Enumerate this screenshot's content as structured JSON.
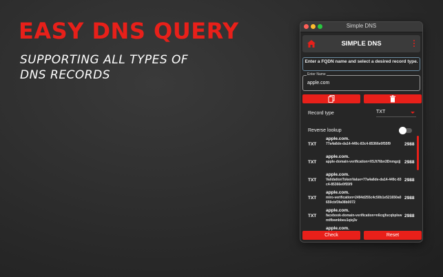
{
  "promo": {
    "title": "EASY DNS QUERY",
    "subtitle": "SUPPORTING ALL TYPES OF DNS RECORDS"
  },
  "window": {
    "title": "Simple DNS"
  },
  "app": {
    "title": "SIMPLE DNS",
    "home_icon": "home-icon",
    "menu_icon": "kebab-menu-icon"
  },
  "info_text": "Enter a FQDN name and select a desired record type.",
  "name_field": {
    "label": "Enter Name",
    "value": "apple.com"
  },
  "buttons": {
    "copy_icon": "copy-icon",
    "delete_icon": "trash-icon",
    "check": "Check",
    "reset": "Reset"
  },
  "record_type": {
    "label": "Record type",
    "value": "TXT"
  },
  "reverse_lookup": {
    "label": "Reverse lookup",
    "enabled": false
  },
  "results": [
    {
      "type": "TXT",
      "domain": "apple.com.",
      "value": "77a4a6de-da14-449c-83c4-85366e0f55f9",
      "ttl": "2988"
    },
    {
      "type": "TXT",
      "domain": "apple.com.",
      "value": "apple-domain-verification=X5Jt76bn3Dnmgzjj",
      "ttl": "2988"
    },
    {
      "type": "TXT",
      "domain": "apple.com.",
      "value": "ValidationTokenValue=77a4a6de-da14-449c-83c4-85366e0f55f9",
      "ttl": "2988"
    },
    {
      "type": "TXT",
      "domain": "apple.com.",
      "value": "miro-verification=2494d255c4c50b1e521650a0659cbf3fa08b0072",
      "ttl": "2988"
    },
    {
      "type": "TXT",
      "domain": "apple.com.",
      "value": "facebook-domain-verification=n6cqjfucqbplswmtfbwnbbeu1qiq3v",
      "ttl": "2988"
    },
    {
      "type": "TXT",
      "domain": "apple.com.",
      "value": "",
      "ttl": ""
    }
  ],
  "colors": {
    "accent": "#e8201a",
    "background": "#262626"
  }
}
